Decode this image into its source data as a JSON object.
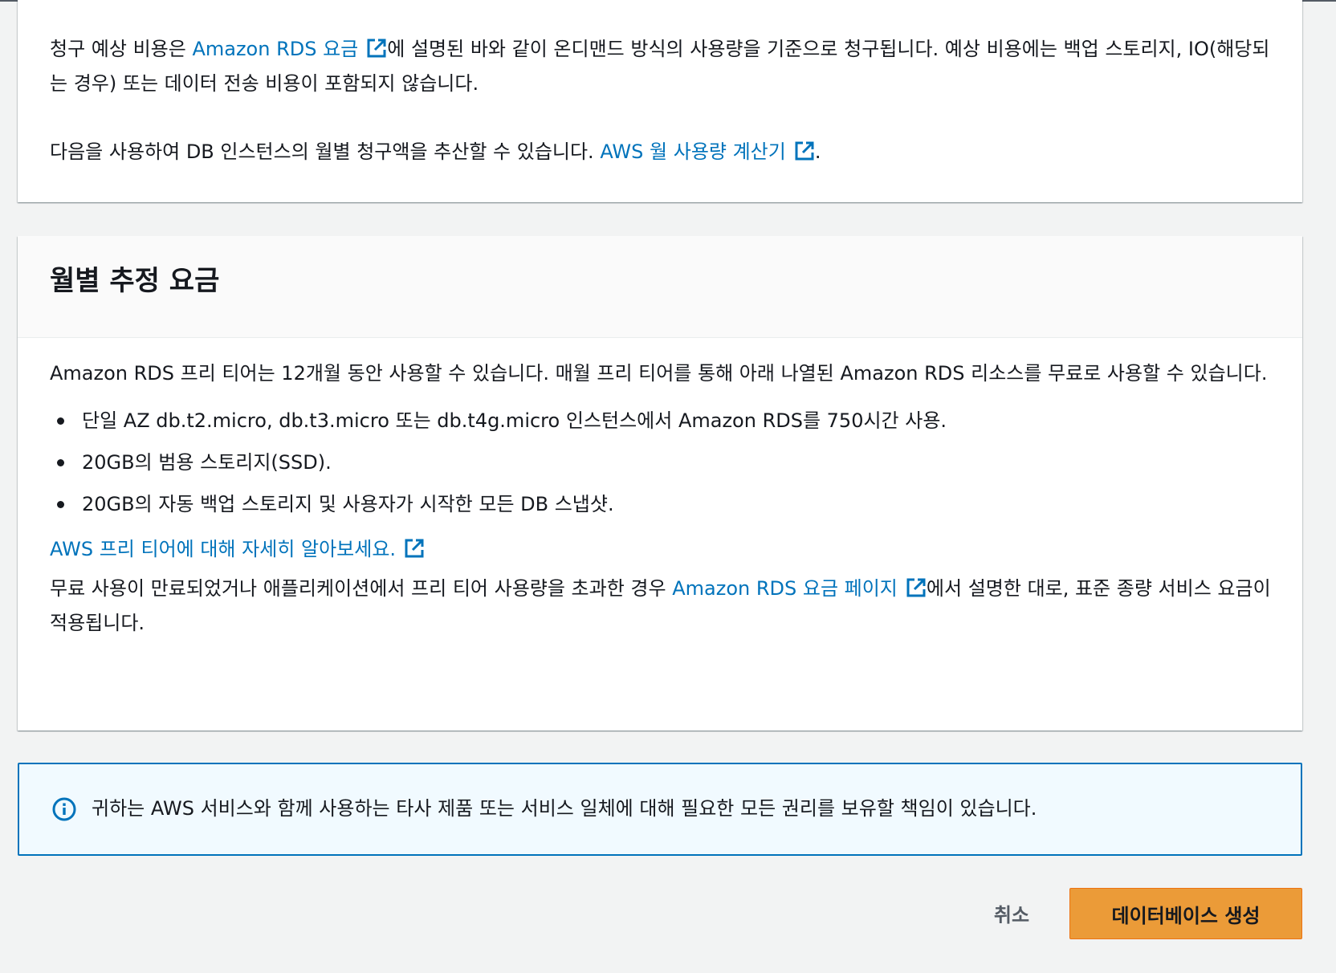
{
  "cost_card": {
    "p1_before": "청구 예상 비용은 ",
    "p1_link": "Amazon RDS 요금",
    "p1_after": "에 설명된 바와 같이 온디맨드 방식의 사용량을 기준으로 청구됩니다. 예상 비용에는 백업 스토리지, IO(해당되는 경우) 또는 데이터 전송 비용이 포함되지 않습니다.",
    "p2_before": "다음을 사용하여 DB 인스턴스의 월별 청구액을 추산할 수 있습니다. ",
    "p2_link": "AWS 월 사용량 계산기",
    "p2_after": "."
  },
  "monthly_card": {
    "title": "월별 추정 요금",
    "intro": "Amazon RDS 프리 티어는 12개월 동안 사용할 수 있습니다. 매월 프리 티어를 통해 아래 나열된 Amazon RDS 리소스를 무료로 사용할 수 있습니다.",
    "bullets": [
      "단일 AZ db.t2.micro, db.t3.micro 또는 db.t4g.micro 인스턴스에서 Amazon RDS를 750시간 사용.",
      "20GB의 범용 스토리지(SSD).",
      "20GB의 자동 백업 스토리지 및 사용자가 시작한 모든 DB 스냅샷."
    ],
    "free_tier_link": "AWS 프리 티어에 대해 자세히 알아보세요.",
    "outro_before": "무료 사용이 만료되었거나 애플리케이션에서 프리 티어 사용량을 초과한 경우 ",
    "outro_link": "Amazon RDS 요금 페이지",
    "outro_after": "에서 설명한 대로, 표준 종량 서비스 요금이 적용됩니다."
  },
  "info_box": {
    "icon": "info-icon",
    "text": "귀하는 AWS 서비스와 함께 사용하는 타사 제품 또는 서비스 일체에 대해 필요한 모든 권리를 보유할 책임이 있습니다."
  },
  "actions": {
    "cancel_label": "취소",
    "create_label": "데이터베이스 생성"
  },
  "colors": {
    "link": "#0073bb",
    "primary_button": "#eb9b38",
    "info_border": "#0073bb",
    "info_bg": "#f1faff"
  }
}
